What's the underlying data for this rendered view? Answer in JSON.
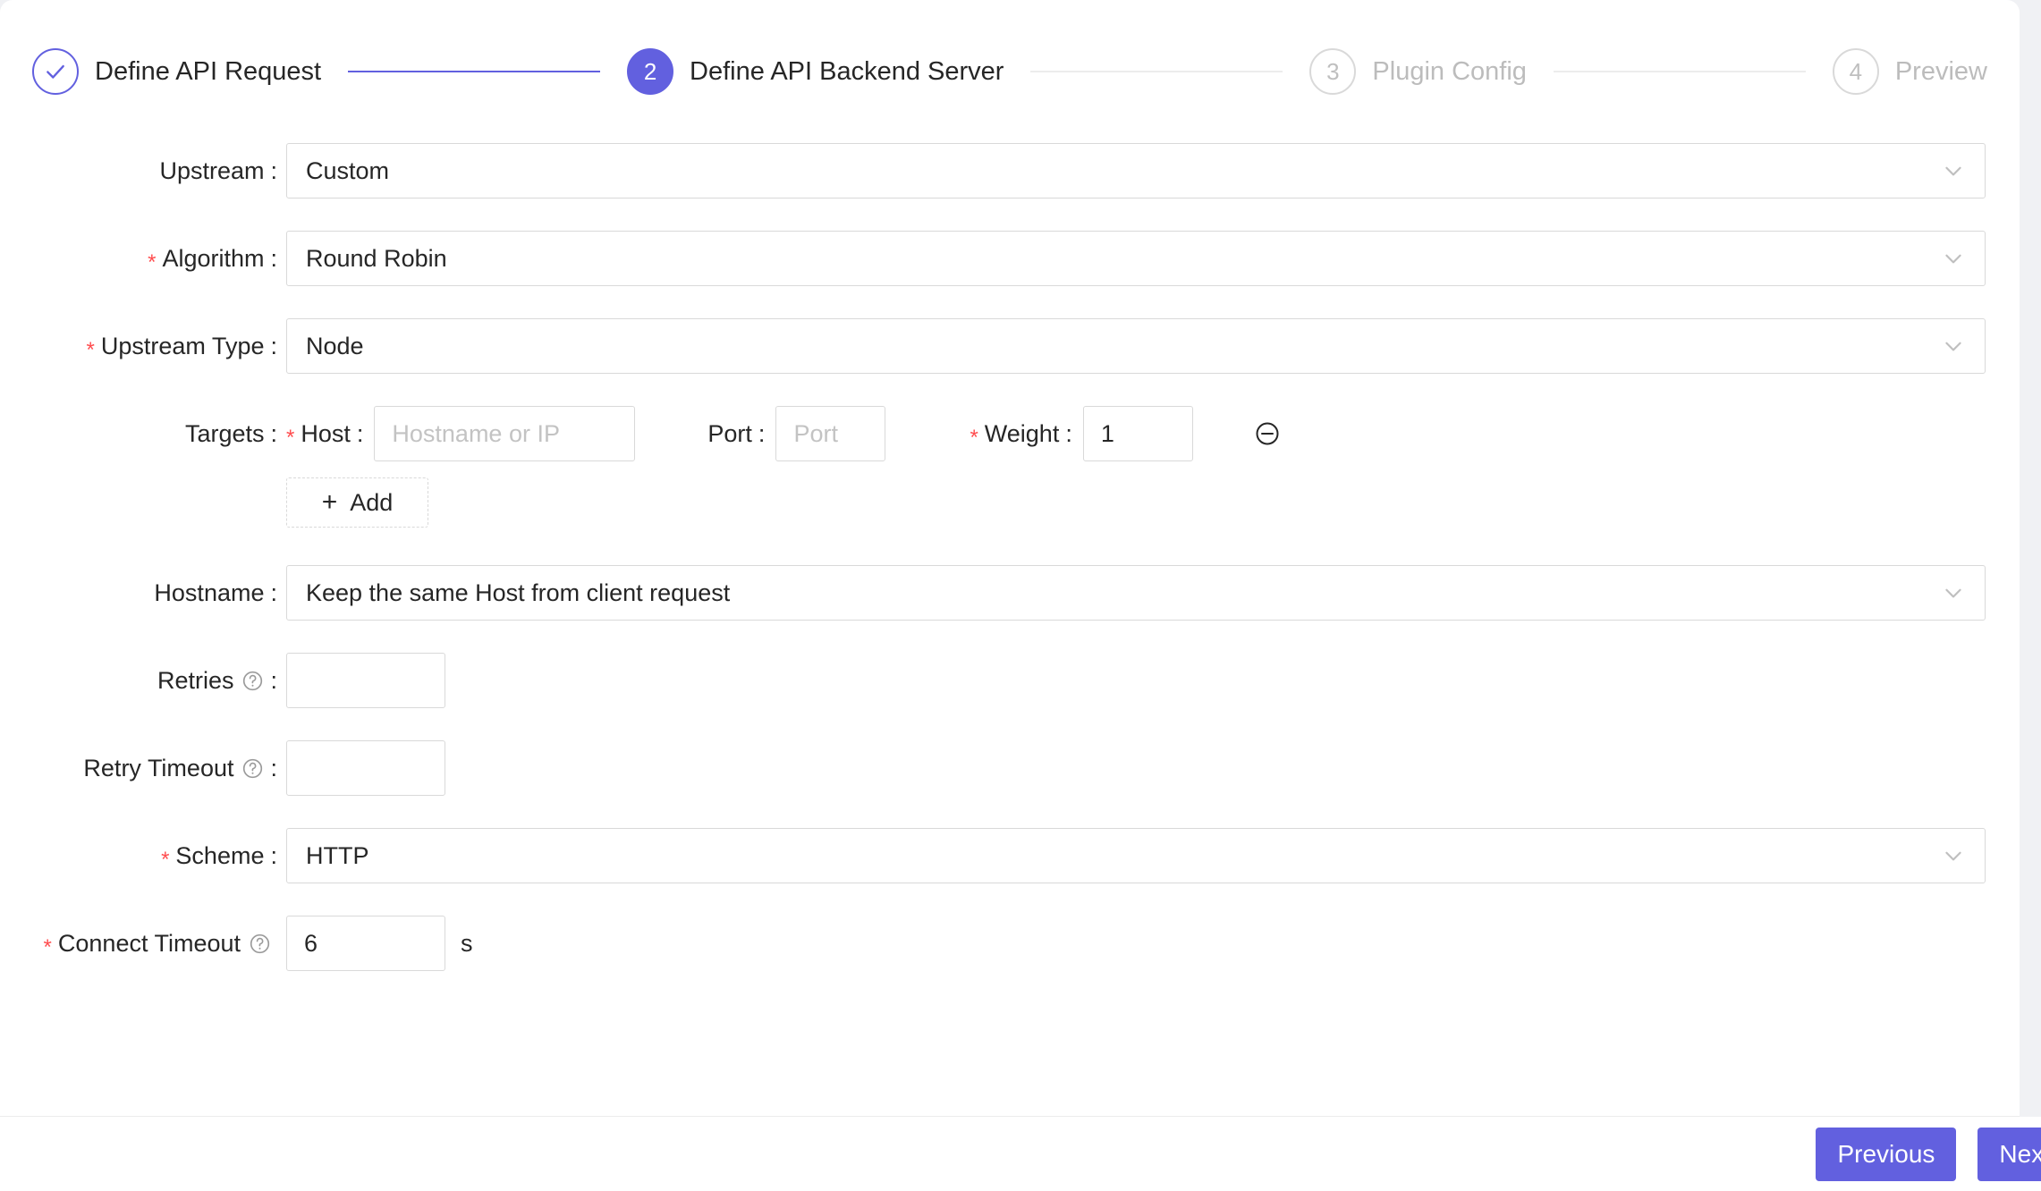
{
  "stepper": {
    "steps": [
      {
        "marker": "check-icon",
        "label": "Define API Request",
        "state": "done"
      },
      {
        "marker": "2",
        "label": "Define API Backend Server",
        "state": "active"
      },
      {
        "marker": "3",
        "label": "Plugin Config",
        "state": "todo"
      },
      {
        "marker": "4",
        "label": "Preview",
        "state": "todo"
      }
    ],
    "accent_color": "#6260df",
    "inactive_color": "#bcbcbc"
  },
  "form": {
    "upstream": {
      "label": "Upstream",
      "colon": ":",
      "value": "Custom",
      "required": false
    },
    "algorithm": {
      "label": "Algorithm",
      "colon": ":",
      "value": "Round Robin",
      "required": true,
      "required_mark": "*"
    },
    "upstream_type": {
      "label": "Upstream Type",
      "colon": ":",
      "value": "Node",
      "required": true,
      "required_mark": "*"
    },
    "targets": {
      "label": "Targets",
      "colon": ":",
      "host": {
        "label": "Host",
        "colon": ":",
        "required_mark": "*",
        "value": "",
        "placeholder": "Hostname or IP"
      },
      "port": {
        "label": "Port",
        "colon": ":",
        "value": "",
        "placeholder": "Port"
      },
      "weight": {
        "label": "Weight",
        "colon": ":",
        "required_mark": "*",
        "value": "1",
        "placeholder": ""
      },
      "remove_icon": "minus-circle-icon",
      "add_label": "Add",
      "add_plus": "+"
    },
    "hostname": {
      "label": "Hostname",
      "colon": ":",
      "value": "Keep the same Host from client request",
      "required": false
    },
    "retries": {
      "label": "Retries",
      "colon": ":",
      "value": "",
      "placeholder": "",
      "help_icon": "question-circle-icon"
    },
    "retry_timeout": {
      "label": "Retry Timeout",
      "colon": ":",
      "value": "",
      "placeholder": "",
      "help_icon": "question-circle-icon"
    },
    "scheme": {
      "label": "Scheme",
      "colon": ":",
      "value": "HTTP",
      "required": true,
      "required_mark": "*"
    },
    "connect_timeout": {
      "label": "Connect Timeout",
      "colon": "",
      "value": "6",
      "suffix": "s",
      "required": true,
      "required_mark": "*",
      "help_icon": "question-circle-icon"
    }
  },
  "footer": {
    "previous_label": "Previous",
    "next_label": "Next",
    "button_color": "#6260df"
  }
}
